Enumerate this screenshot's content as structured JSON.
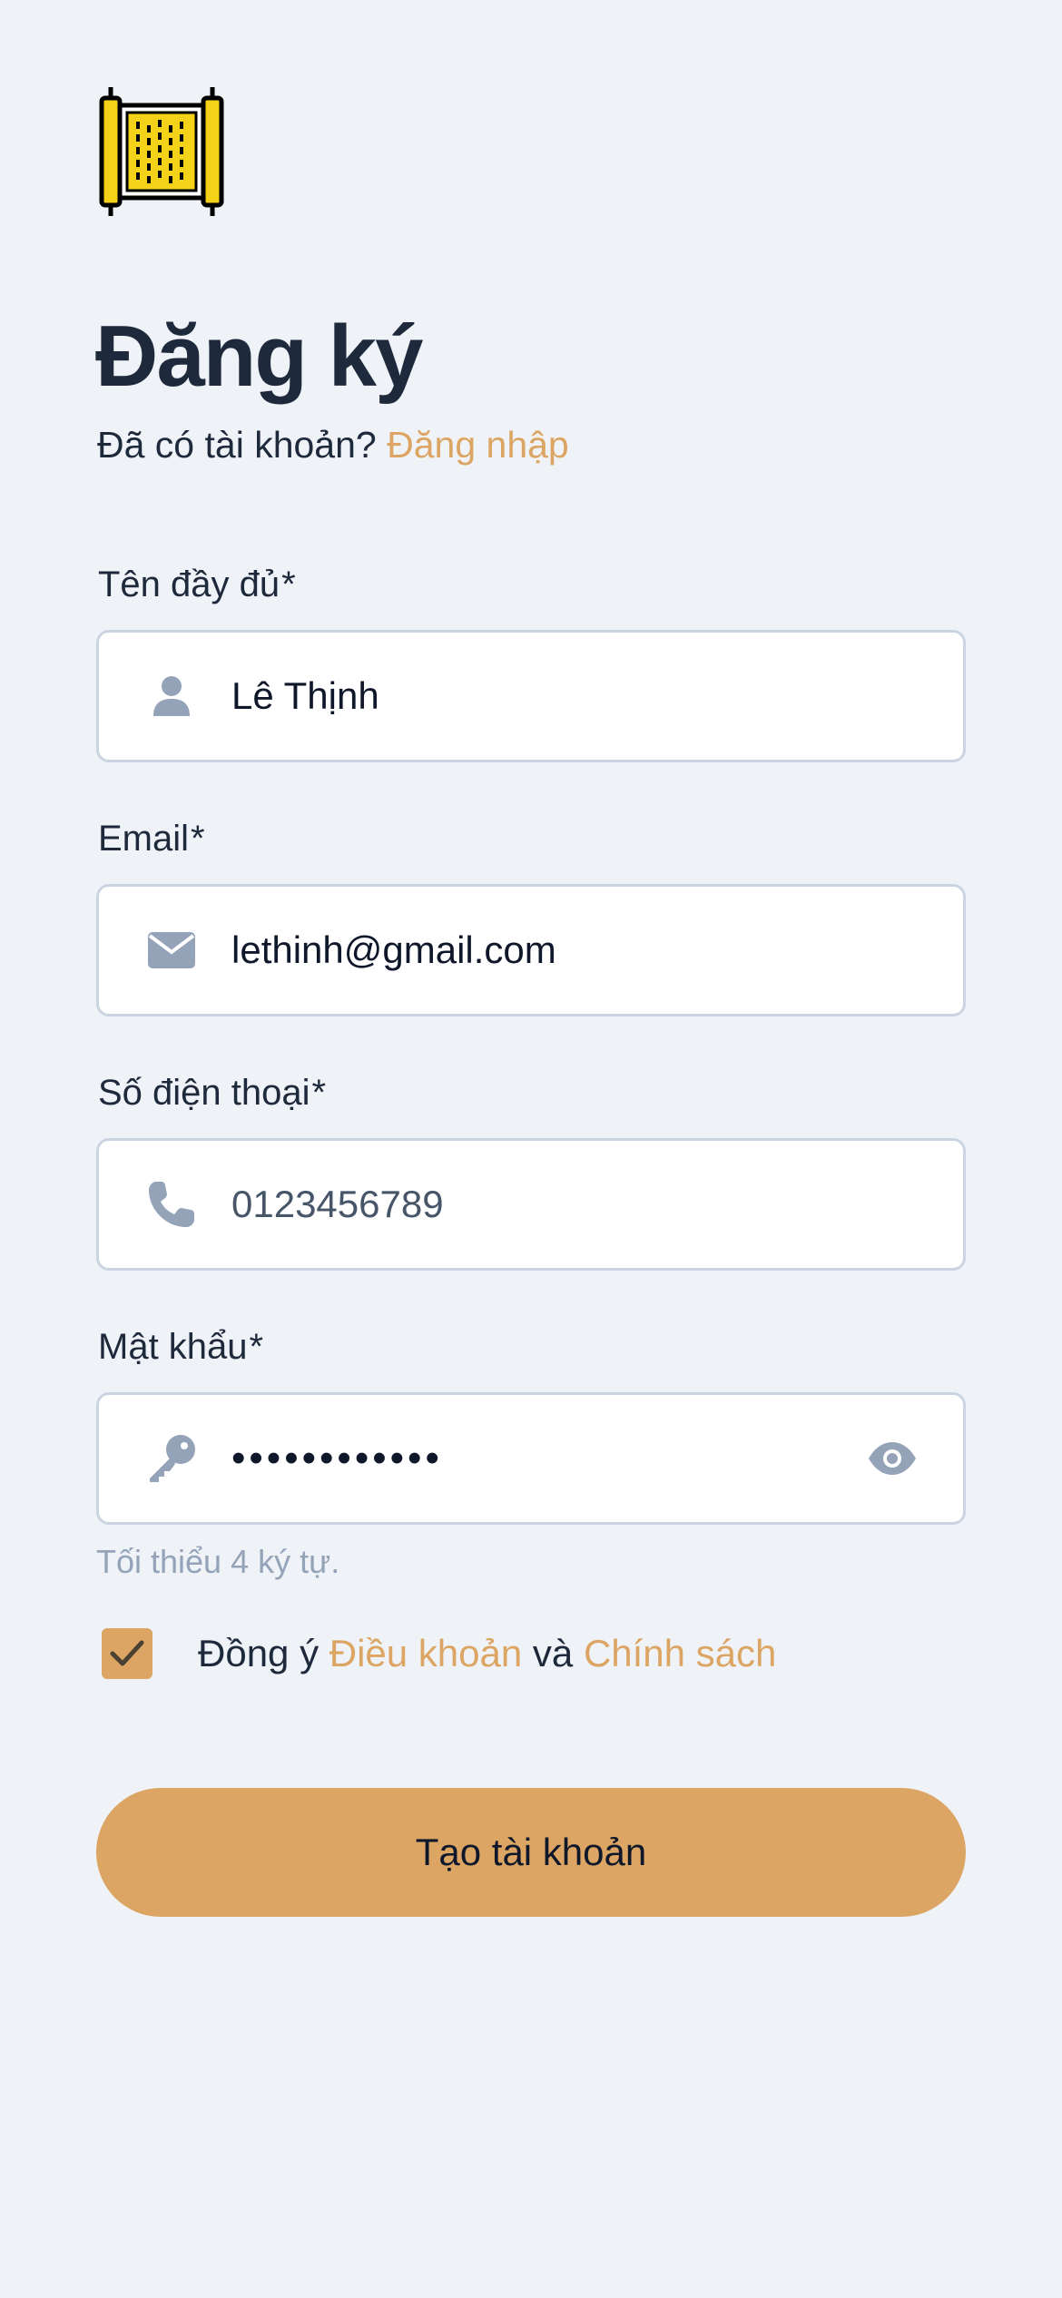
{
  "header": {
    "logo_icon": "scroll-icon",
    "title": "Đăng ký",
    "subtitle_prefix": "Đã có tài khoản?",
    "login_link": "Đăng nhập"
  },
  "form": {
    "fullname": {
      "label": "Tên đầy đủ",
      "required_mark": "*",
      "icon": "user-icon",
      "value": "Lê Thịnh"
    },
    "email": {
      "label": "Email",
      "required_mark": "*",
      "icon": "envelope-icon",
      "value": "lethinh@gmail.com"
    },
    "phone": {
      "label": "Số điện thoại",
      "required_mark": "*",
      "icon": "phone-icon",
      "value": "0123456789"
    },
    "password": {
      "label": "Mật khẩu",
      "required_mark": "*",
      "icon": "key-icon",
      "value": "••••••••••••",
      "toggle_icon": "eye-icon",
      "hint": "Tối thiểu 4 ký tự."
    },
    "agree": {
      "checked": true,
      "prefix": "Đồng ý",
      "terms_link": "Điều khoản",
      "conjunction": "và",
      "policy_link": "Chính sách"
    },
    "submit_label": "Tạo tài khoản"
  },
  "colors": {
    "background": "#eff3f8",
    "accent": "#dca563",
    "text": "#1e293b",
    "muted": "#94a3b8",
    "icon": "#94a3b8",
    "border": "#cbd5e1"
  }
}
